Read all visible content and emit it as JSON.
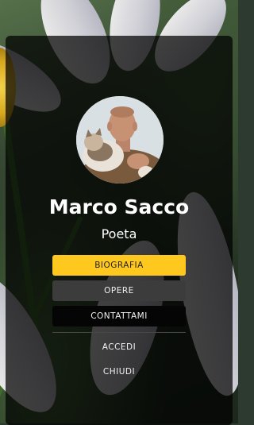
{
  "profile": {
    "name": "Marco Sacco",
    "role": "Poeta"
  },
  "menu": {
    "biografia": "BIOGRAFIA",
    "opere": "OPERE",
    "contattami": "CONTATTAMI",
    "accedi": "ACCEDI",
    "chiudi": "CHIUDI"
  },
  "colors": {
    "accent": "#ffc81e",
    "secondary_button": "#3c3c3c",
    "dark_button": "#050505",
    "text": "#ffffff"
  }
}
